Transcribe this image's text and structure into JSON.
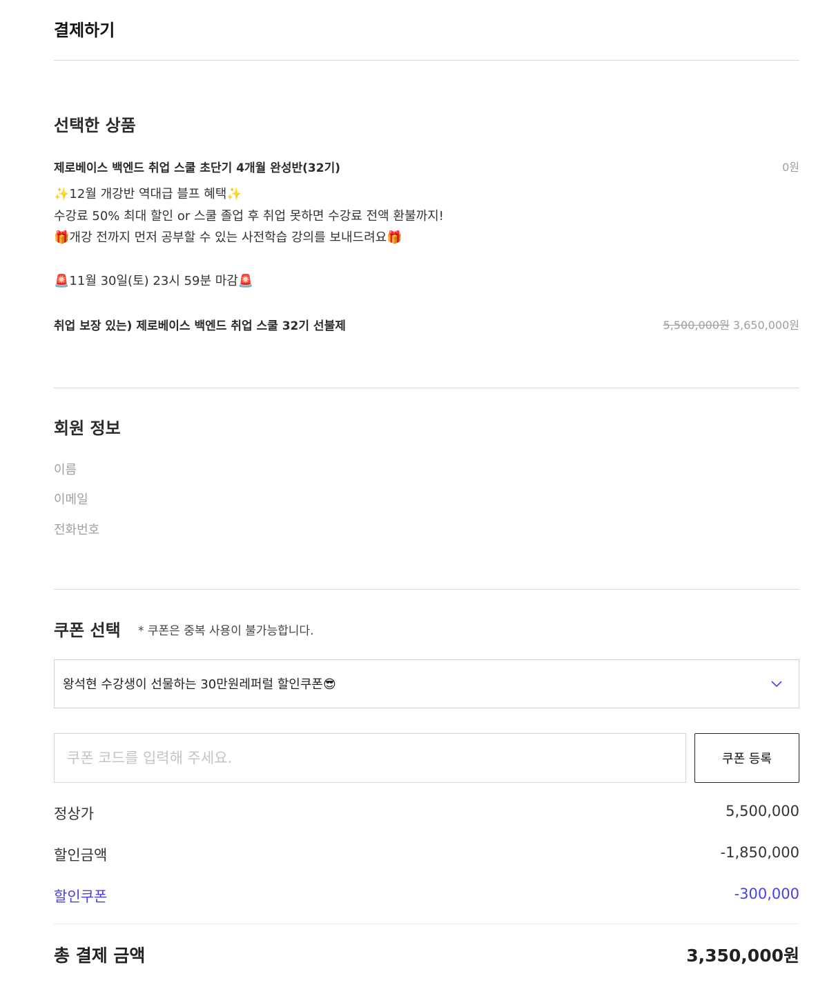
{
  "page": {
    "title": "결제하기"
  },
  "product_section": {
    "title": "선택한 상품",
    "product": {
      "name": "제로베이스 백엔드 취업 스쿨 초단기 4개월 완성반(32기)",
      "price": "0원"
    },
    "description": {
      "line1": "✨12월 개강반 역대급 블프 혜택✨",
      "line2": "수강료 50% 최대 할인 or 스쿨 졸업 후 취업 못하면 수강료 전액 환불까지!",
      "line3": "🎁개강 전까지 먼저 공부할 수 있는 사전학습 강의를 보내드려요🎁",
      "line4": "🚨11월 30일(토) 23시 59분 마감🚨"
    },
    "option": {
      "name": "취업 보장 있는) 제로베이스 백엔드 취업 스쿨 32기 선불제",
      "original_price": "5,500,000원",
      "sale_price": "3,650,000원"
    }
  },
  "member_section": {
    "title": "회원 정보",
    "name_label": "이름",
    "email_label": "이메일",
    "phone_label": "전화번호"
  },
  "coupon_section": {
    "title": "쿠폰 선택",
    "note": "* 쿠폰은 중복 사용이 불가능합니다.",
    "selected_coupon": "왕석현 수강생이 선물하는 30만원레퍼럴 할인쿠폰😎",
    "code_placeholder": "쿠폰 코드를 입력해 주세요.",
    "register_button": "쿠폰 등록"
  },
  "summary": {
    "regular_label": "정상가",
    "regular_value": "5,500,000",
    "discount_label": "할인금액",
    "discount_value": "-1,850,000",
    "coupon_label": "할인쿠폰",
    "coupon_value": "-300,000",
    "total_label": "총 결제 금액",
    "total_value": "3,350,000원"
  },
  "colors": {
    "accent": "#4a3fe8",
    "divider": "#d9d9d9",
    "muted": "#a0a0a0"
  },
  "icons": {
    "select_chevron": "chevron-down-icon"
  }
}
